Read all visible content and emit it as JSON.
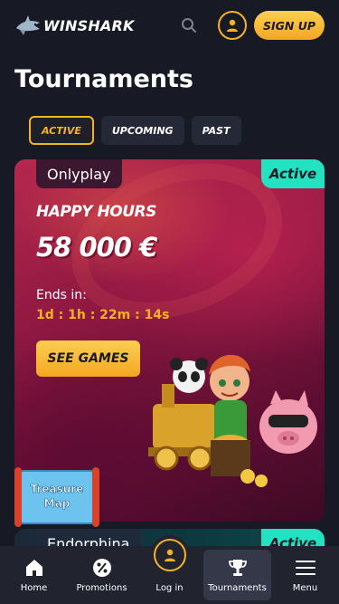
{
  "header": {
    "logo_text": "WINSHARK",
    "signup_label": "SIGN UP"
  },
  "page": {
    "title": "Tournaments"
  },
  "tabs": [
    {
      "label": "ACTIVE",
      "active": true
    },
    {
      "label": "UPCOMING",
      "active": false
    },
    {
      "label": "PAST",
      "active": false
    }
  ],
  "tournaments": [
    {
      "provider": "Onlyplay",
      "status": "Active",
      "name": "HAPPY HOURS",
      "prize": "58 000 €",
      "ends_label": "Ends in:",
      "countdown": "1d : 1h : 22m : 14s",
      "cta": "SEE GAMES"
    },
    {
      "provider": "Endorphina",
      "status": "Active"
    }
  ],
  "treasure_map": {
    "line1": "Treasure",
    "line2": "Map"
  },
  "bottom_nav": [
    {
      "label": "Home",
      "icon": "home-icon"
    },
    {
      "label": "Promotions",
      "icon": "percent-icon"
    },
    {
      "label": "Log in",
      "icon": "user-icon"
    },
    {
      "label": "Tournaments",
      "icon": "trophy-icon",
      "active": true
    },
    {
      "label": "Menu",
      "icon": "menu-icon"
    }
  ],
  "colors": {
    "background": "#171a24",
    "accent": "#f5b324",
    "active_badge": "#23e2c2",
    "nav_bg": "#21242f"
  }
}
